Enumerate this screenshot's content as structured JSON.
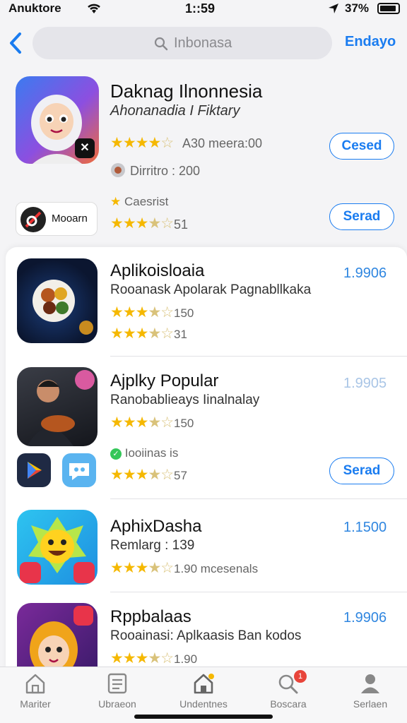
{
  "status_bar": {
    "carrier": "Anuktore",
    "time": "1::59",
    "battery": "37%"
  },
  "nav": {
    "search_term": "Inbonasa",
    "action_label": "Endayo"
  },
  "featured": {
    "title": "Daknag Ilnonnesia",
    "subtitle": "Ahonanadia I Fiktary",
    "rating_text": "A30 meera:00",
    "meta": "Dirritro : 200",
    "get_label": "Cesed",
    "secondary_app": {
      "name": "Mooarn",
      "badge_text": "Caesrist",
      "rating_count": "51",
      "get_label": "Serad"
    }
  },
  "results": [
    {
      "title": "Aplikoisloaia",
      "subtitle": "Rooanask Apolarak Pagnabllkaka",
      "price": "1.9906",
      "rating_1": "150",
      "rating_2": "31",
      "price_faded": false
    },
    {
      "title": "Ajplky Popular",
      "subtitle": "Ranobablieays Iinalnalay",
      "price": "1.9905",
      "rating_1": "150",
      "tag": "Iooiinas is",
      "rating_2": "57",
      "get_label": "Serad",
      "price_faded": true
    },
    {
      "title": "AphixDasha",
      "subtitle": "Remlarg : 139",
      "price": "1.1500",
      "rating_1": "1.90 mcesenals",
      "price_faded": false
    },
    {
      "title": "Rppbalaas",
      "subtitle": "Rooainasi: Aplkaasis Ban kodos",
      "price": "1.9906",
      "rating_1": "1.90",
      "price_faded": false
    }
  ],
  "tabs": [
    {
      "label": "Mariter",
      "icon": "house-icon"
    },
    {
      "label": "Ubraeon",
      "icon": "list-icon"
    },
    {
      "label": "Undentnes",
      "icon": "home-icon"
    },
    {
      "label": "Boscara",
      "icon": "search-icon",
      "badge": "1"
    },
    {
      "label": "Serlaen",
      "icon": "person-icon"
    }
  ],
  "colors": {
    "accent": "#1a7cf0",
    "star": "#f5b800",
    "badge": "#e8443a"
  }
}
